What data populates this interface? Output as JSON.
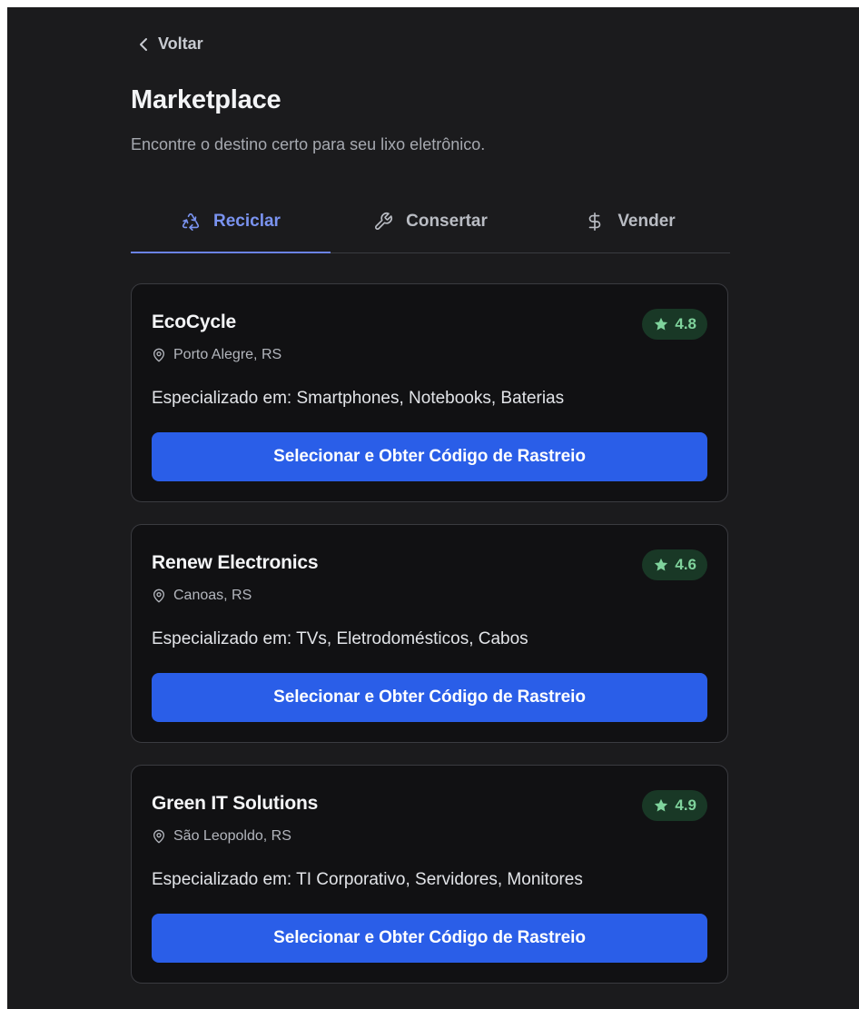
{
  "header": {
    "back_label": "Voltar",
    "title": "Marketplace",
    "subtitle": "Encontre o destino certo para seu lixo eletrônico."
  },
  "tabs": [
    {
      "label": "Reciclar",
      "icon": "recycle-icon",
      "active": true
    },
    {
      "label": "Consertar",
      "icon": "wrench-icon",
      "active": false
    },
    {
      "label": "Vender",
      "icon": "dollar-icon",
      "active": false
    }
  ],
  "cards": [
    {
      "name": "EcoCycle",
      "rating": "4.8",
      "location": "Porto Alegre, RS",
      "specialization": "Especializado em: Smartphones, Notebooks, Baterias",
      "button_label": "Selecionar e Obter Código de Rastreio"
    },
    {
      "name": "Renew Electronics",
      "rating": "4.6",
      "location": "Canoas, RS",
      "specialization": "Especializado em: TVs, Eletrodomésticos, Cabos",
      "button_label": "Selecionar e Obter Código de Rastreio"
    },
    {
      "name": "Green IT Solutions",
      "rating": "4.9",
      "location": "São Leopoldo, RS",
      "specialization": "Especializado em: TI Corporativo, Servidores, Monitores",
      "button_label": "Selecionar e Obter Código de Rastreio"
    }
  ],
  "colors": {
    "background": "#1b1b1d",
    "card_background": "#111113",
    "accent": "#2a5ee8",
    "active_tab": "#7a93f0",
    "rating_text": "#7fd39c",
    "rating_background": "#193826"
  }
}
